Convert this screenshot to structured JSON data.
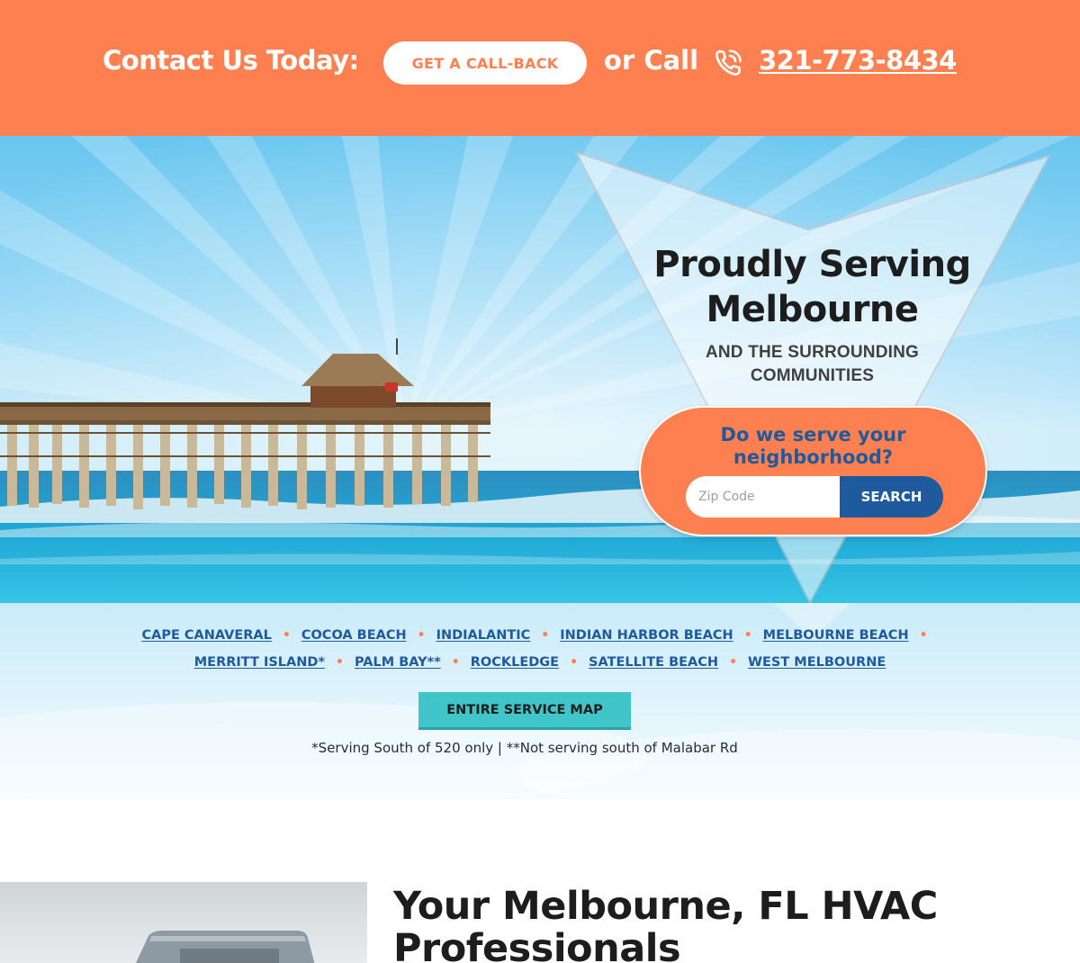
{
  "contact_bar": {
    "title": "Contact Us Today:",
    "callback_label": "GET A CALL-BACK",
    "or_call": "or Call",
    "phone": "321-773-8434",
    "icon": "phone-ringing-icon"
  },
  "hero": {
    "title_line1": "Proudly Serving",
    "title_line2": "Melbourne",
    "subtitle": "AND THE SURROUNDING COMMUNITIES",
    "zip_question": "Do we serve your neighborhood?",
    "zip_placeholder": "Zip Code",
    "search_label": "SEARCH"
  },
  "communities": {
    "row1": [
      "CAPE CANAVERAL",
      "COCOA BEACH",
      "INDIALANTIC",
      "INDIAN HARBOR BEACH",
      "MELBOURNE BEACH"
    ],
    "row2": [
      "MERRITT ISLAND*",
      "PALM BAY**",
      "ROCKLEDGE",
      "SATELLITE BEACH",
      "WEST MELBOURNE"
    ],
    "separator": "•",
    "map_button": "ENTIRE SERVICE MAP",
    "note": "*Serving South of 520 only | **Not serving south of Malabar Rd"
  },
  "section": {
    "title": "Your Melbourne, FL HVAC Professionals"
  },
  "colors": {
    "accent_orange": "#fe8050",
    "brand_blue": "#1f5a9e",
    "teal_button": "#40c5c8",
    "dark_text": "#1d1d1d"
  }
}
